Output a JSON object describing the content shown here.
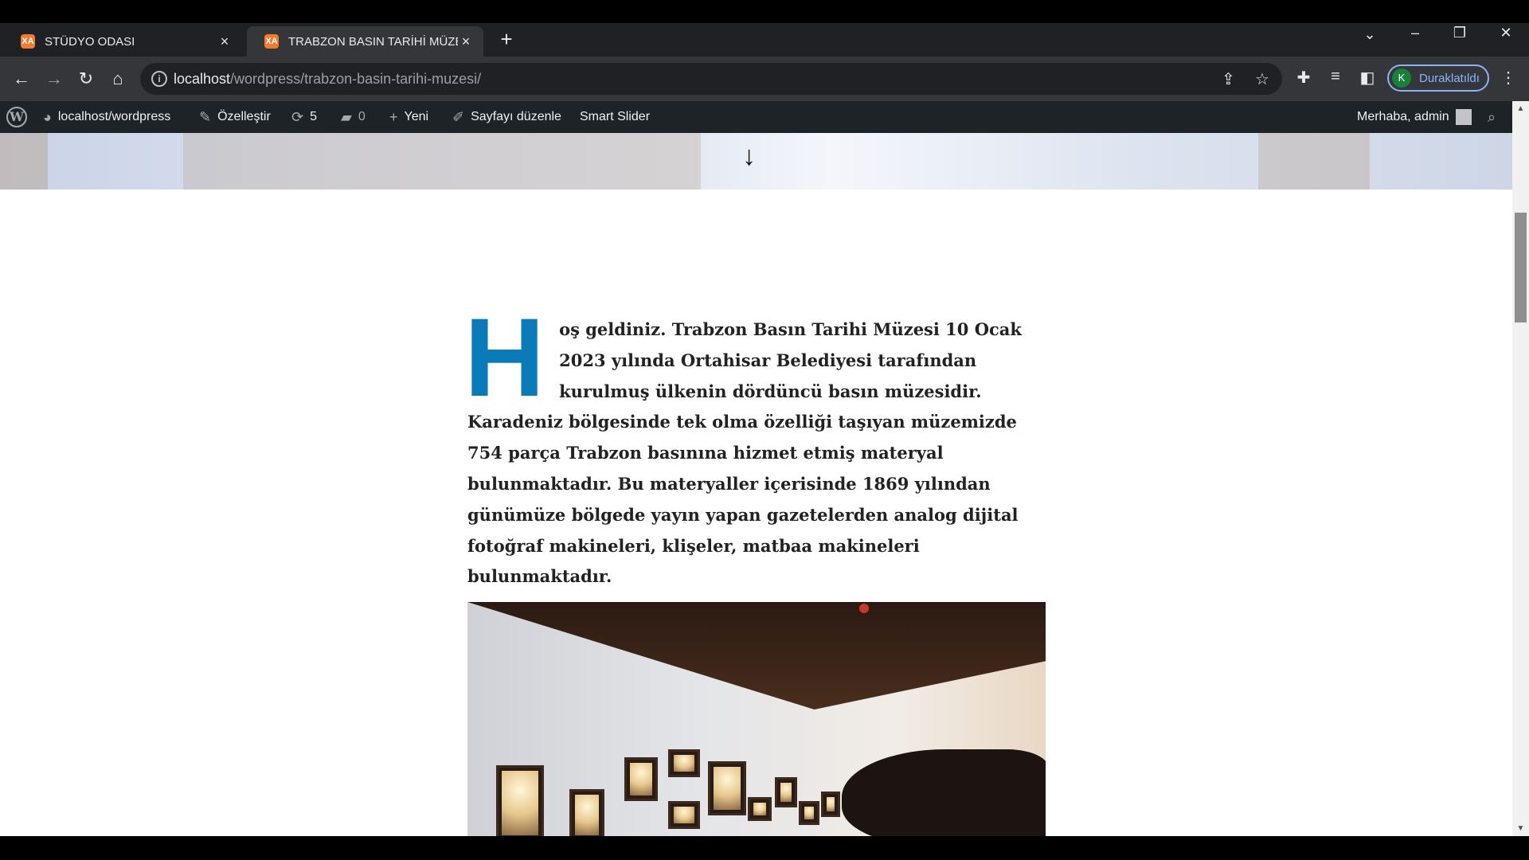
{
  "browser": {
    "tabs": [
      {
        "title": "STÜDYO ODASI",
        "active": false
      },
      {
        "title": "TRABZON BASIN TARİHİ MÜZES",
        "active": true
      }
    ],
    "favicon_text": "XA",
    "close_glyph": "×",
    "new_tab_glyph": "+",
    "url_host": "localhost",
    "url_path": "/wordpress/trabzon-basin-tarihi-muzesi/",
    "profile_initial": "K",
    "profile_label": "Duraklatıldı"
  },
  "adminbar": {
    "site": "localhost/wordpress",
    "customize": "Özelleştir",
    "updates": "5",
    "comments": "0",
    "new": "Yeni",
    "edit_page": "Sayfayı düzenle",
    "smart_slider": "Smart Slider",
    "greeting": "Merhaba, admin"
  },
  "article": {
    "dropcap": "H",
    "text": "oş geldiniz. Trabzon Basın Tarihi Müzesi 10 Ocak 2023 yılında Ortahisar Belediyesi tarafından kurulmuş ülkenin dördüncü basın müzesidir. Karadeniz bölgesinde tek olma özelliği taşıyan müzemizde 754 parça Trabzon basınına hizmet etmiş materyal bulunmaktadır. Bu materyaller içerisinde 1869 yılından günümüze bölgede yayın yapan gazetelerden analog dijital fotoğraf makineleri, klişeler, matbaa makineleri bulunmaktadır."
  },
  "colors": {
    "dropcap": "#0a7bb8",
    "adminbar": "#1d2327",
    "profile_accent": "#8ab4f8"
  }
}
